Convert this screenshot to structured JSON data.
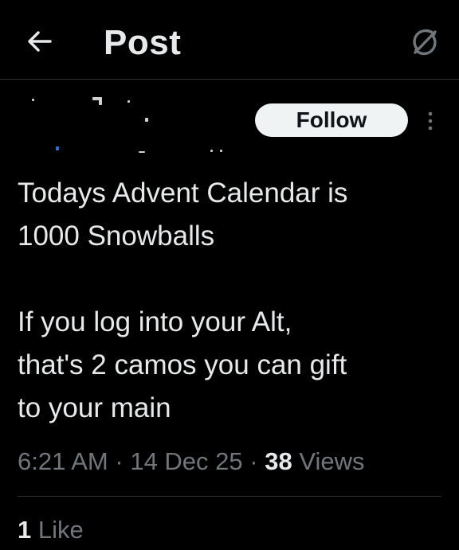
{
  "header": {
    "back_icon": "arrow-left-icon",
    "title": "Post",
    "grok_icon": "grok-icon"
  },
  "author": {
    "follow_label": "Follow",
    "more_icon": "more-vertical-icon"
  },
  "post": {
    "text": "Todays Advent Calendar is\n1000 Snowballs\n\nIf you log into your Alt,\nthat's 2 camos you can gift\nto your main",
    "time": "6:21 AM",
    "separator": "·",
    "date": "14 Dec 25",
    "views_count": "38",
    "views_label": "Views"
  },
  "engagement": {
    "likes_count": "1",
    "likes_label": "Like"
  },
  "colors": {
    "background": "#000000",
    "text_primary": "#e7e9ea",
    "text_secondary": "#71767b",
    "divider": "#2f3336",
    "follow_bg": "#eff3f4",
    "follow_text": "#0f1419"
  }
}
